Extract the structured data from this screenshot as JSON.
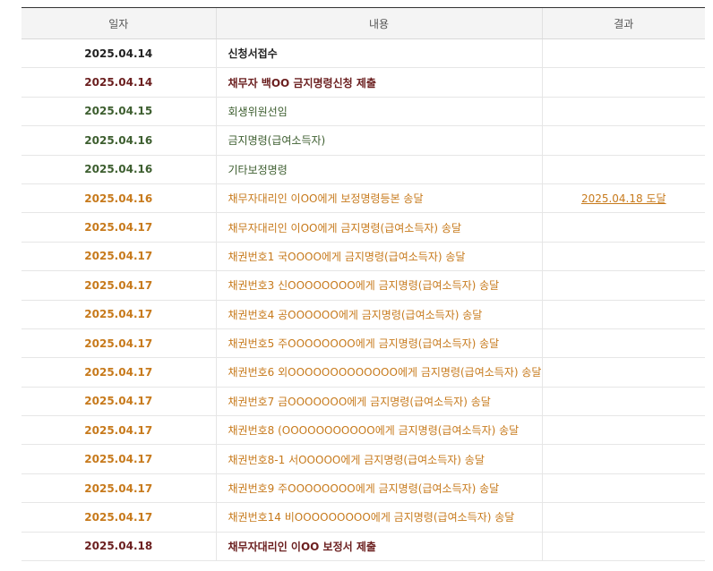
{
  "table": {
    "headers": [
      "일자",
      "내용",
      "결과"
    ],
    "rows": [
      {
        "date": "2025.04.14",
        "content": "신청서접수",
        "result": "",
        "color": "black",
        "bold": true
      },
      {
        "date": "2025.04.14",
        "content": "채무자 백OO 금지명령신청 제출",
        "result": "",
        "color": "darkred",
        "bold": true
      },
      {
        "date": "2025.04.15",
        "content": "회생위원선임",
        "result": "",
        "color": "green",
        "bold": false
      },
      {
        "date": "2025.04.16",
        "content": "금지명령(급여소득자)",
        "result": "",
        "color": "green",
        "bold": false
      },
      {
        "date": "2025.04.16",
        "content": "기타보정명령",
        "result": "",
        "color": "green",
        "bold": false
      },
      {
        "date": "2025.04.16",
        "content": "채무자대리인 이OO에게 보정명령등본 송달",
        "result": "2025.04.18 도달",
        "color": "orange",
        "bold": false
      },
      {
        "date": "2025.04.17",
        "content": "채무자대리인 이OO에게 금지명령(급여소득자) 송달",
        "result": "",
        "color": "orange",
        "bold": false
      },
      {
        "date": "2025.04.17",
        "content": "채권번호1 국OOOO에게 금지명령(급여소득자) 송달",
        "result": "",
        "color": "orange",
        "bold": false
      },
      {
        "date": "2025.04.17",
        "content": "채권번호3 신OOOOOOOO에게 금지명령(급여소득자) 송달",
        "result": "",
        "color": "orange",
        "bold": false
      },
      {
        "date": "2025.04.17",
        "content": "채권번호4 공OOOOOO에게 금지명령(급여소득자) 송달",
        "result": "",
        "color": "orange",
        "bold": false
      },
      {
        "date": "2025.04.17",
        "content": "채권번호5 주OOOOOOOO에게 금지명령(급여소득자) 송달",
        "result": "",
        "color": "orange",
        "bold": false
      },
      {
        "date": "2025.04.17",
        "content": "채권번호6 외OOOOOOOOOOOOO에게 금지명령(급여소득자) 송달",
        "result": "",
        "color": "orange",
        "bold": false
      },
      {
        "date": "2025.04.17",
        "content": "채권번호7 금OOOOOOO에게 금지명령(급여소득자) 송달",
        "result": "",
        "color": "orange",
        "bold": false
      },
      {
        "date": "2025.04.17",
        "content": "채권번호8 (OOOOOOOOOOO에게 금지명령(급여소득자) 송달",
        "result": "",
        "color": "orange",
        "bold": false
      },
      {
        "date": "2025.04.17",
        "content": "채권번호8-1 서OOOOO에게 금지명령(급여소득자) 송달",
        "result": "",
        "color": "orange",
        "bold": false
      },
      {
        "date": "2025.04.17",
        "content": "채권번호9 주OOOOOOOO에게 금지명령(급여소득자) 송달",
        "result": "",
        "color": "orange",
        "bold": false
      },
      {
        "date": "2025.04.17",
        "content": "채권번호14 비OOOOOOOOO에게 금지명령(급여소득자) 송달",
        "result": "",
        "color": "orange",
        "bold": false
      },
      {
        "date": "2025.04.18",
        "content": "채무자대리인 이OO 보정서 제출",
        "result": "",
        "color": "darkred",
        "bold": true
      }
    ]
  },
  "colors": {
    "black": "#222222",
    "darkred": "#6b1f1f",
    "green": "#3d5e2f",
    "orange": "#c77a1c",
    "header_bg": "#f4f4f4"
  }
}
